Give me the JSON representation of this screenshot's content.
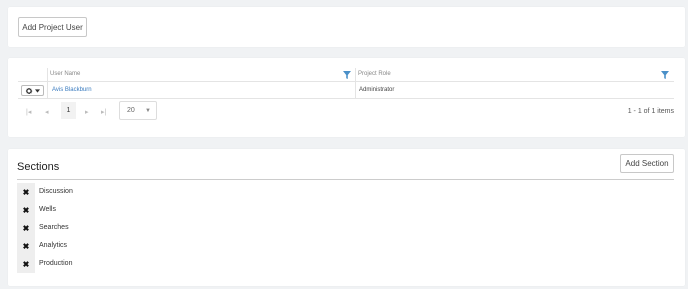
{
  "toolbar": {
    "add_project_user_label": "Add Project User"
  },
  "grid": {
    "columns": [
      {
        "label": "User Name"
      },
      {
        "label": "Project Role"
      }
    ],
    "rows": [
      {
        "user_name": "Avis Blackburn",
        "project_role": "Administrator"
      }
    ],
    "pager": {
      "current_page": "1",
      "page_size": "20",
      "info": "1 - 1 of 1 items"
    }
  },
  "sections": {
    "title": "Sections",
    "add_label": "Add Section",
    "items": [
      {
        "label": "Discussion"
      },
      {
        "label": "Wells"
      },
      {
        "label": "Searches"
      },
      {
        "label": "Analytics"
      },
      {
        "label": "Production"
      }
    ]
  },
  "colors": {
    "link": "#3a7bbf",
    "filter": "#4a90c8"
  }
}
